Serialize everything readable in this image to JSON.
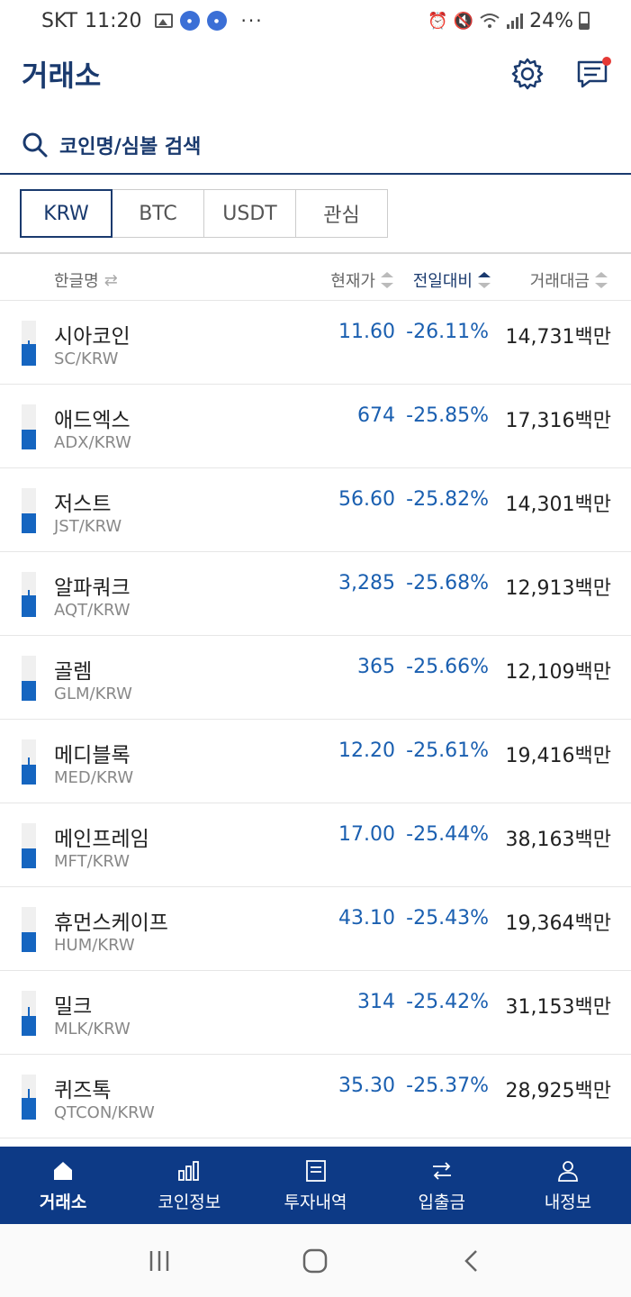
{
  "status_bar": {
    "carrier": "SKT",
    "time": "11:20",
    "battery": "24%"
  },
  "header": {
    "title": "거래소"
  },
  "search": {
    "placeholder": "코인명/심볼 검색"
  },
  "tabs": [
    {
      "label": "KRW",
      "active": true
    },
    {
      "label": "BTC",
      "active": false
    },
    {
      "label": "USDT",
      "active": false
    },
    {
      "label": "관심",
      "active": false
    }
  ],
  "columns": {
    "name": "한글명",
    "price": "현재가",
    "change": "전일대비",
    "volume": "거래대금"
  },
  "coins": [
    {
      "name": "시아코인",
      "symbol": "SC/KRW",
      "price": "11.60",
      "change": "-26.11%",
      "volume": "14,731백만"
    },
    {
      "name": "애드엑스",
      "symbol": "ADX/KRW",
      "price": "674",
      "change": "-25.85%",
      "volume": "17,316백만"
    },
    {
      "name": "저스트",
      "symbol": "JST/KRW",
      "price": "56.60",
      "change": "-25.82%",
      "volume": "14,301백만"
    },
    {
      "name": "알파쿼크",
      "symbol": "AQT/KRW",
      "price": "3,285",
      "change": "-25.68%",
      "volume": "12,913백만"
    },
    {
      "name": "골렘",
      "symbol": "GLM/KRW",
      "price": "365",
      "change": "-25.66%",
      "volume": "12,109백만"
    },
    {
      "name": "메디블록",
      "symbol": "MED/KRW",
      "price": "12.20",
      "change": "-25.61%",
      "volume": "19,416백만"
    },
    {
      "name": "메인프레임",
      "symbol": "MFT/KRW",
      "price": "17.00",
      "change": "-25.44%",
      "volume": "38,163백만"
    },
    {
      "name": "휴먼스케이프",
      "symbol": "HUM/KRW",
      "price": "43.10",
      "change": "-25.43%",
      "volume": "19,364백만"
    },
    {
      "name": "밀크",
      "symbol": "MLK/KRW",
      "price": "314",
      "change": "-25.42%",
      "volume": "31,153백만"
    },
    {
      "name": "퀴즈톡",
      "symbol": "QTCON/KRW",
      "price": "35.30",
      "change": "-25.37%",
      "volume": "28,925백만"
    }
  ],
  "bottom_nav": [
    {
      "label": "거래소",
      "icon": "home-icon"
    },
    {
      "label": "코인정보",
      "icon": "bar-chart-icon"
    },
    {
      "label": "투자내역",
      "icon": "document-icon"
    },
    {
      "label": "입출금",
      "icon": "transfer-icon"
    },
    {
      "label": "내정보",
      "icon": "user-icon"
    }
  ],
  "colors": {
    "brand": "#0d3a86",
    "fall": "#1a5fb0"
  }
}
